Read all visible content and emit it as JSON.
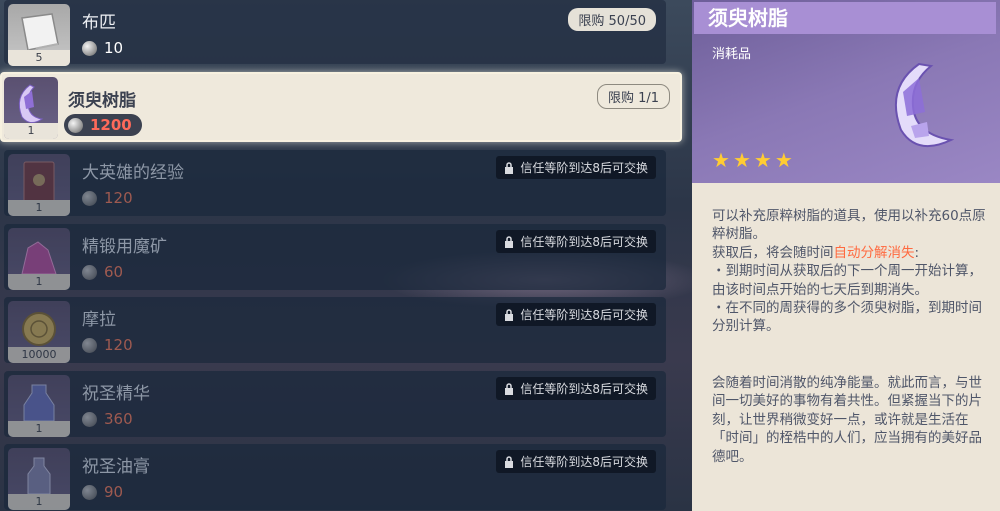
{
  "items": [
    {
      "name": "布匹",
      "price": "10",
      "qty": "5",
      "limit": "限购 50/50",
      "locked": false,
      "selected": false
    },
    {
      "name": "须臾树脂",
      "price": "1200",
      "qty": "1",
      "limit": "限购 1/1",
      "locked": false,
      "selected": true
    },
    {
      "name": "大英雄的经验",
      "price": "120",
      "qty": "1",
      "lock_text": "信任等阶到达8后可交换",
      "locked": true
    },
    {
      "name": "精锻用魔矿",
      "price": "60",
      "qty": "1",
      "lock_text": "信任等阶到达8后可交换",
      "locked": true
    },
    {
      "name": "摩拉",
      "price": "120",
      "qty": "10000",
      "lock_text": "信任等阶到达8后可交换",
      "locked": true
    },
    {
      "name": "祝圣精华",
      "price": "360",
      "qty": "1",
      "lock_text": "信任等阶到达8后可交换",
      "locked": true
    },
    {
      "name": "祝圣油膏",
      "price": "90",
      "qty": "1",
      "lock_text": "信任等阶到达8后可交换",
      "locked": true
    }
  ],
  "detail": {
    "title": "须臾树脂",
    "category": "消耗品",
    "stars": 4,
    "desc_line1": "可以补充原粹树脂的道具，使用以补充60点原粹树脂。",
    "desc_line2_prefix": "获取后，将会随时间",
    "desc_line2_highlight": "自动分解消失",
    "desc_line2_suffix": ":",
    "bullet1": "・到期时间从获取后的下一个周一开始计算，由该时间点开始的七天后到期消失。",
    "bullet2": "・在不同的周获得的多个须臾树脂，到期时间分别计算。",
    "flavor": "会随着时间消散的纯净能量。就此而言，与世间一切美好的事物有着共性。但紧握当下的片刻，让世界稍微变好一点，或许就是生活在「时间」的桎梏中的人们，应当拥有的美好品德吧。"
  },
  "colors": {
    "accent": "#a88fd4",
    "price_red": "#ff6a5a",
    "star": "#ffcc33",
    "panel_bg": "#ece5d8"
  }
}
